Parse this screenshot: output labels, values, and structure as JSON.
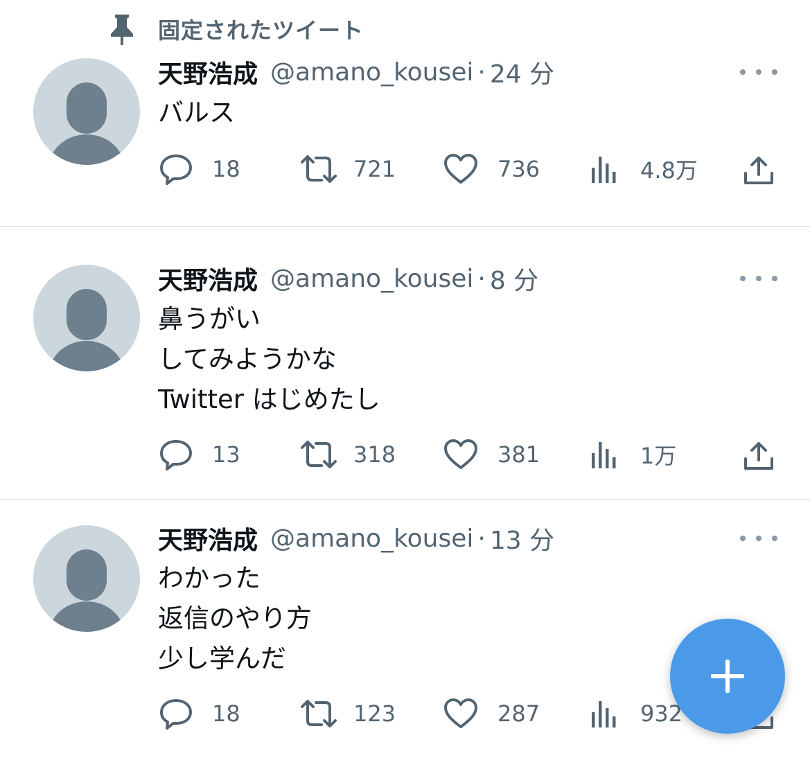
{
  "pinned_label": "固定されたツイート",
  "tweets": [
    {
      "name": "天野浩成",
      "handle": "@amano_kousei",
      "sep": "·",
      "time": "24 分",
      "lines": [
        "バルス"
      ],
      "replies": "18",
      "retweets": "721",
      "likes": "736",
      "views": "4.8万"
    },
    {
      "name": "天野浩成",
      "handle": "@amano_kousei",
      "sep": "·",
      "time": "8 分",
      "lines": [
        "鼻うがい",
        "してみようかな",
        "Twitter はじめたし"
      ],
      "replies": "13",
      "retweets": "318",
      "likes": "381",
      "views": "1万"
    },
    {
      "name": "天野浩成",
      "handle": "@amano_kousei",
      "sep": "·",
      "time": "13 分",
      "lines": [
        "わかった",
        "返信のやり方",
        "少し学んだ"
      ],
      "replies": "18",
      "retweets": "123",
      "likes": "287",
      "views": "932"
    }
  ],
  "colors": {
    "accent": "#4b9ae9",
    "secondary_text": "#536471",
    "avatar_bg": "#ccd6dd",
    "avatar_figure": "#6e7f8d",
    "divider": "#cfd9de"
  },
  "icons": {
    "pinned": "pin-icon",
    "reply": "reply-icon",
    "retweet": "retweet-icon",
    "like": "heart-icon",
    "views": "views-icon",
    "share": "share-icon",
    "more": "more-icon",
    "compose": "plus-icon"
  }
}
